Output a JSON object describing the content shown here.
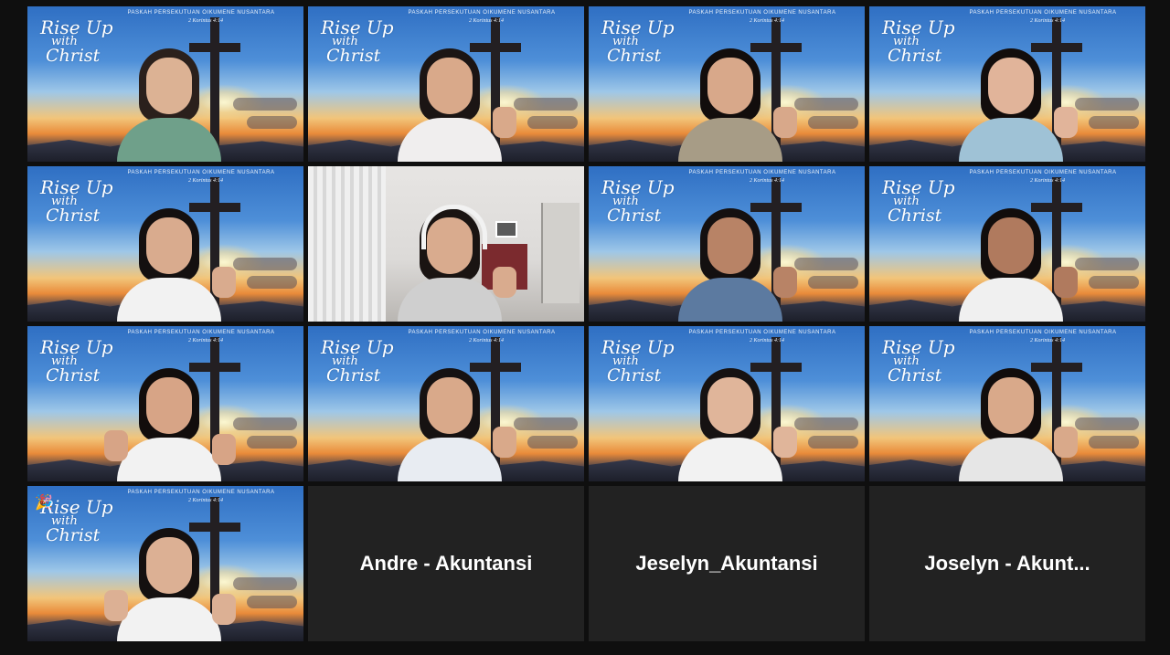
{
  "meeting": {
    "background_text": {
      "event": "PASKAH PERSEKUTUAN OIKUMENE NUSANTARA",
      "verse": "2 Korintus 4:14",
      "logo_line1": "Rise Up",
      "logo_line2": "with",
      "logo_line3": "Christ"
    },
    "colors": {
      "active_speaker_border": "#d8e04a",
      "tile_empty_bg": "#222222",
      "app_bg": "#0f0f0f"
    },
    "tiles": [
      {
        "type": "video",
        "bg": "virtual",
        "active": false,
        "skin": "#dcb294",
        "hair": "#2a201c",
        "shirt": "#6fa08a",
        "thumbs": 0
      },
      {
        "type": "video",
        "bg": "virtual",
        "active": true,
        "skin": "#d9a98a",
        "hair": "#1b1514",
        "shirt": "#f0eeee",
        "thumbs": 1
      },
      {
        "type": "video",
        "bg": "virtual",
        "active": false,
        "skin": "#d8a88a",
        "hair": "#120d0c",
        "shirt": "#a79c86",
        "thumbs": 1
      },
      {
        "type": "video",
        "bg": "virtual",
        "active": false,
        "skin": "#e1b49a",
        "hair": "#120d0c",
        "shirt": "#9fc2d6",
        "thumbs": 1
      },
      {
        "type": "video",
        "bg": "virtual",
        "active": false,
        "skin": "#d9ab8e",
        "hair": "#141010",
        "shirt": "#f2f2f2",
        "thumbs": 1
      },
      {
        "type": "video",
        "bg": "room",
        "active": false,
        "skin": "#d9ab8e",
        "hair": "#1a1412",
        "shirt": "#cfcfcf",
        "thumbs": 1
      },
      {
        "type": "video",
        "bg": "virtual",
        "active": false,
        "skin": "#b88366",
        "hair": "#141010",
        "shirt": "#5c7aa0",
        "thumbs": 1
      },
      {
        "type": "video",
        "bg": "virtual",
        "active": false,
        "skin": "#b07a5e",
        "hair": "#120d0c",
        "shirt": "#f0f0f0",
        "thumbs": 1
      },
      {
        "type": "video",
        "bg": "virtual",
        "active": false,
        "skin": "#d7a486",
        "hair": "#120d0c",
        "shirt": "#f2f2f2",
        "thumbs": 2
      },
      {
        "type": "video",
        "bg": "virtual",
        "active": false,
        "skin": "#d9a98a",
        "hair": "#161212",
        "shirt": "#e8ecf2",
        "thumbs": 1
      },
      {
        "type": "video",
        "bg": "virtual",
        "active": false,
        "skin": "#e0b59a",
        "hair": "#161212",
        "shirt": "#f2f2f2",
        "thumbs": 1
      },
      {
        "type": "video",
        "bg": "virtual",
        "active": false,
        "skin": "#d9a98a",
        "hair": "#120d0c",
        "shirt": "#e6e6e6",
        "thumbs": 1
      },
      {
        "type": "video",
        "bg": "virtual",
        "active": false,
        "skin": "#dcb094",
        "hair": "#141010",
        "shirt": "#f2f2f2",
        "thumbs": 2,
        "reaction": "party-popper"
      },
      {
        "type": "name",
        "name": "Andre - Akuntansi"
      },
      {
        "type": "name",
        "name": "Jeselyn_Akuntansi"
      },
      {
        "type": "name",
        "name": "Joselyn  -  Akunt..."
      }
    ]
  }
}
